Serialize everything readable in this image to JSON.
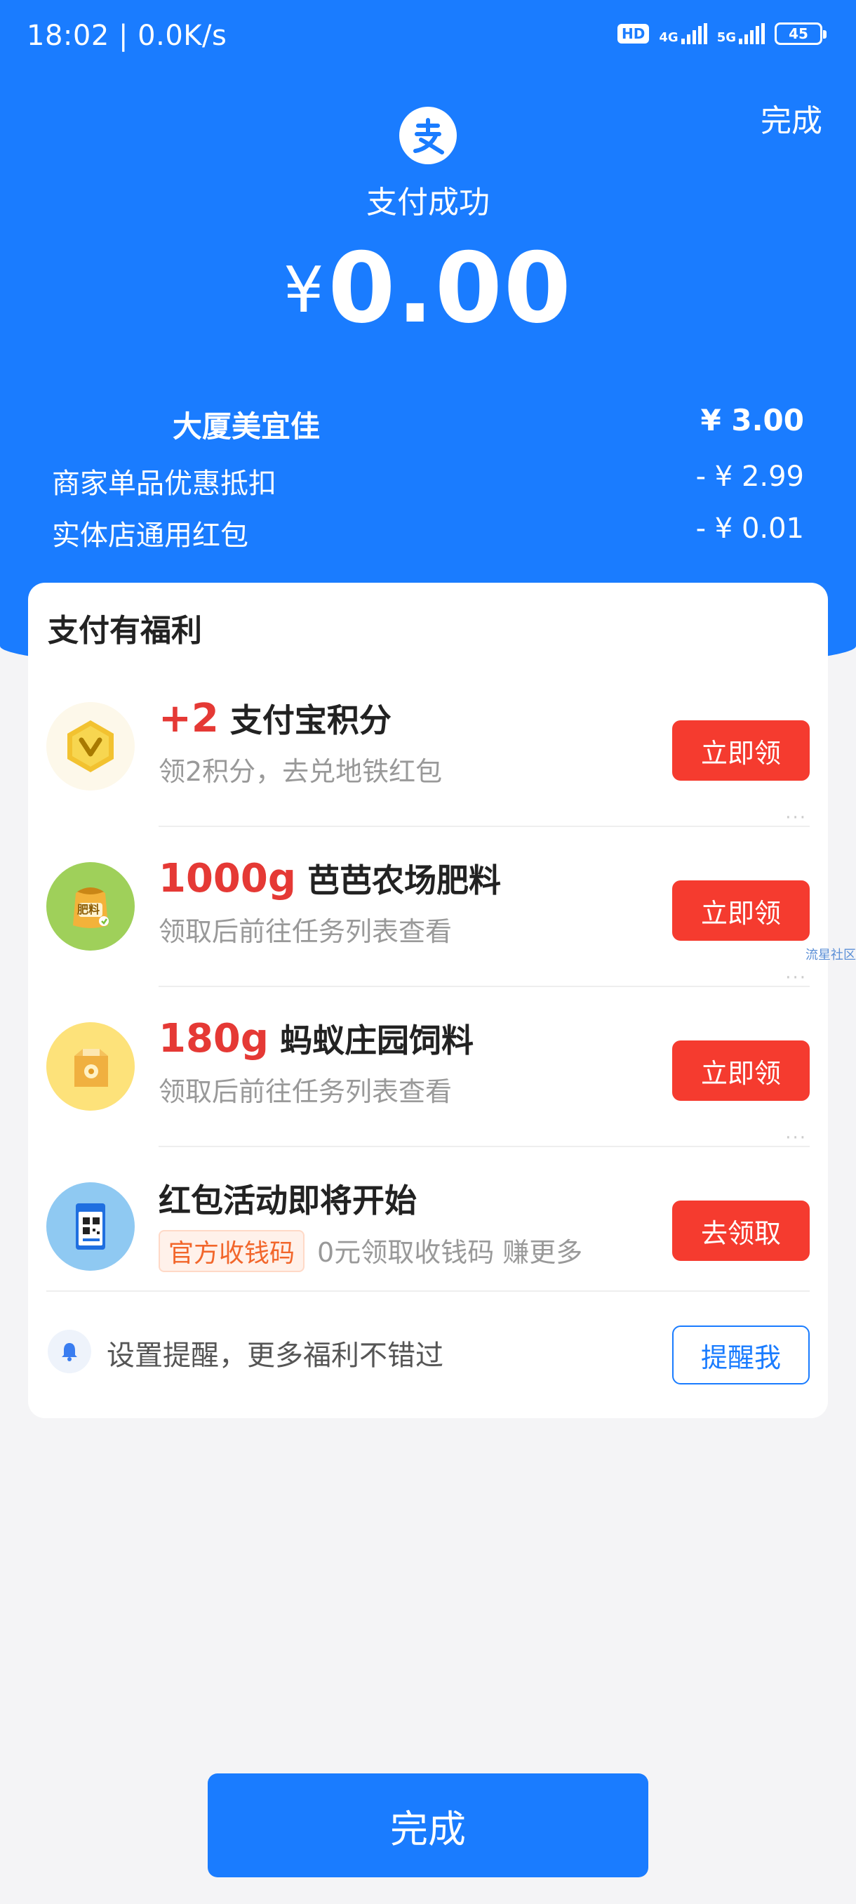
{
  "status_bar": {
    "time": "18:02 | 0.0K/s",
    "hd_label": "HD",
    "net1": "4G",
    "net2": "5G",
    "battery": "45"
  },
  "header": {
    "done_label": "完成",
    "success_title": "支付成功",
    "currency": "¥",
    "amount": "0.00"
  },
  "bill": {
    "merchant_name": "大厦美宜佳",
    "merchant_amount": "¥ 3.00",
    "discounts": [
      {
        "label": "商家单品优惠抵扣",
        "amount": "- ¥ 2.99"
      },
      {
        "label": "实体店通用红包",
        "amount": "- ¥ 0.01"
      }
    ]
  },
  "benefits": {
    "title": "支付有福利",
    "items": [
      {
        "highlight": "+2",
        "title": " 支付宝积分",
        "subtitle": "领2积分，去兑地铁红包",
        "button": "立即领",
        "icon": "gold-v-coin-icon"
      },
      {
        "highlight": "1000g",
        "title": " 芭芭农场肥料",
        "subtitle": "领取后前往任务列表查看",
        "button": "立即领",
        "icon": "fertilizer-bag-icon",
        "icon_text": "肥料"
      },
      {
        "highlight": "180g",
        "title": " 蚂蚁庄园饲料",
        "subtitle": "领取后前往任务列表查看",
        "button": "立即领",
        "icon": "feed-bag-icon"
      },
      {
        "highlight": "",
        "title": "红包活动即将开始",
        "tag": "官方收钱码",
        "subtitle": "0元领取收钱码 赚更多",
        "button": "去领取",
        "icon": "qr-code-card-icon"
      }
    ],
    "more": "···",
    "remind_text": "设置提醒，更多福利不错过",
    "remind_button": "提醒我"
  },
  "watermark": "流星社区",
  "footer": {
    "done_label": "完成"
  },
  "colors": {
    "brand_blue": "#1a7cff",
    "button_red": "#f53b2f",
    "highlight_red": "#e53935"
  }
}
